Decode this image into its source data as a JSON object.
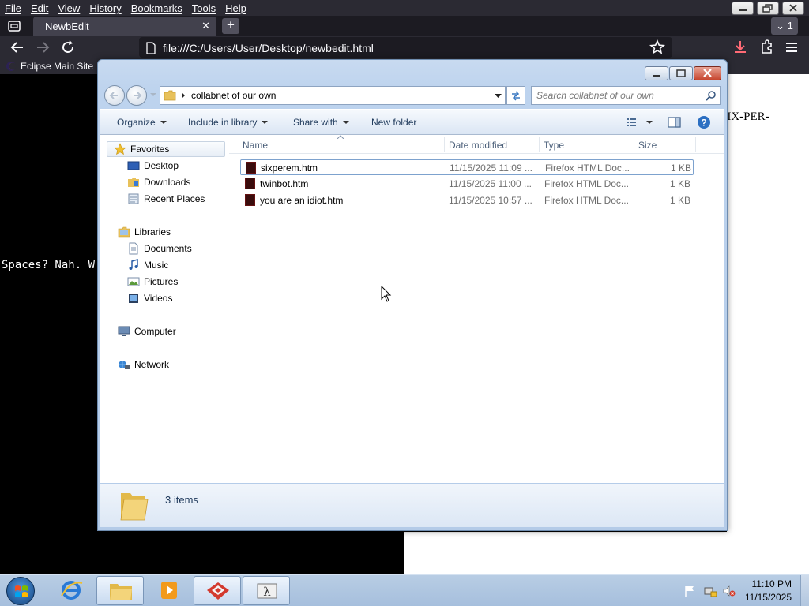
{
  "browser": {
    "menu": [
      "File",
      "Edit",
      "View",
      "History",
      "Bookmarks",
      "Tools",
      "Help"
    ],
    "tab_title": "NewbEdit",
    "tab_count": "1",
    "url": "file:///C:/Users/User/Desktop/newbedit.html",
    "bookmarks": [
      "Eclipse Main Site"
    ]
  },
  "page": {
    "text_right": "SIX-PER-",
    "text_left": "Spaces? Nah. W"
  },
  "explorer": {
    "address_path": "collabnet of our own",
    "search_placeholder": "Search collabnet of our own",
    "toolbar": {
      "organize": "Organize",
      "include_in_library": "Include in library",
      "share_with": "Share with",
      "new_folder": "New folder"
    },
    "nav": {
      "favorites": "Favorites",
      "desktop": "Desktop",
      "downloads": "Downloads",
      "recent_places": "Recent Places",
      "libraries": "Libraries",
      "documents": "Documents",
      "music": "Music",
      "pictures": "Pictures",
      "videos": "Videos",
      "computer": "Computer",
      "network": "Network"
    },
    "columns": {
      "name": "Name",
      "date_modified": "Date modified",
      "type": "Type",
      "size": "Size"
    },
    "files": [
      {
        "name": "sixperem.htm",
        "date": "11/15/2025 11:09 ...",
        "type": "Firefox HTML Doc...",
        "size": "1 KB"
      },
      {
        "name": "twinbot.htm",
        "date": "11/15/2025 11:00 ...",
        "type": "Firefox HTML Doc...",
        "size": "1 KB"
      },
      {
        "name": "you are an idiot.htm",
        "date": "11/15/2025 10:57 ...",
        "type": "Firefox HTML Doc...",
        "size": "1 KB"
      }
    ],
    "item_count": "3 items"
  },
  "taskbar": {
    "time": "11:10 PM",
    "date": "11/15/2025"
  }
}
